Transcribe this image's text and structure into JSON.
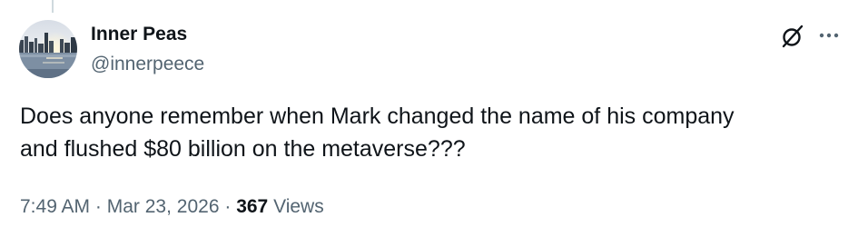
{
  "author": {
    "name": "Inner Peas",
    "handle": "@innerpeece"
  },
  "icons": {
    "avatar": "avatar-city-skyline-sunset",
    "grok": "grok-icon",
    "more": "more-dots-icon"
  },
  "tweet": {
    "lines": [
      "Does anyone remember when Mark changed the name of his company",
      "and flushed $80 billion on the metaverse???"
    ]
  },
  "meta": {
    "time": "7:49 AM",
    "separator": "·",
    "date": "Mar 23, 2026",
    "views_count": "367",
    "views_label": "Views"
  },
  "colors": {
    "text_primary": "#0f1419",
    "text_secondary": "#536471"
  }
}
